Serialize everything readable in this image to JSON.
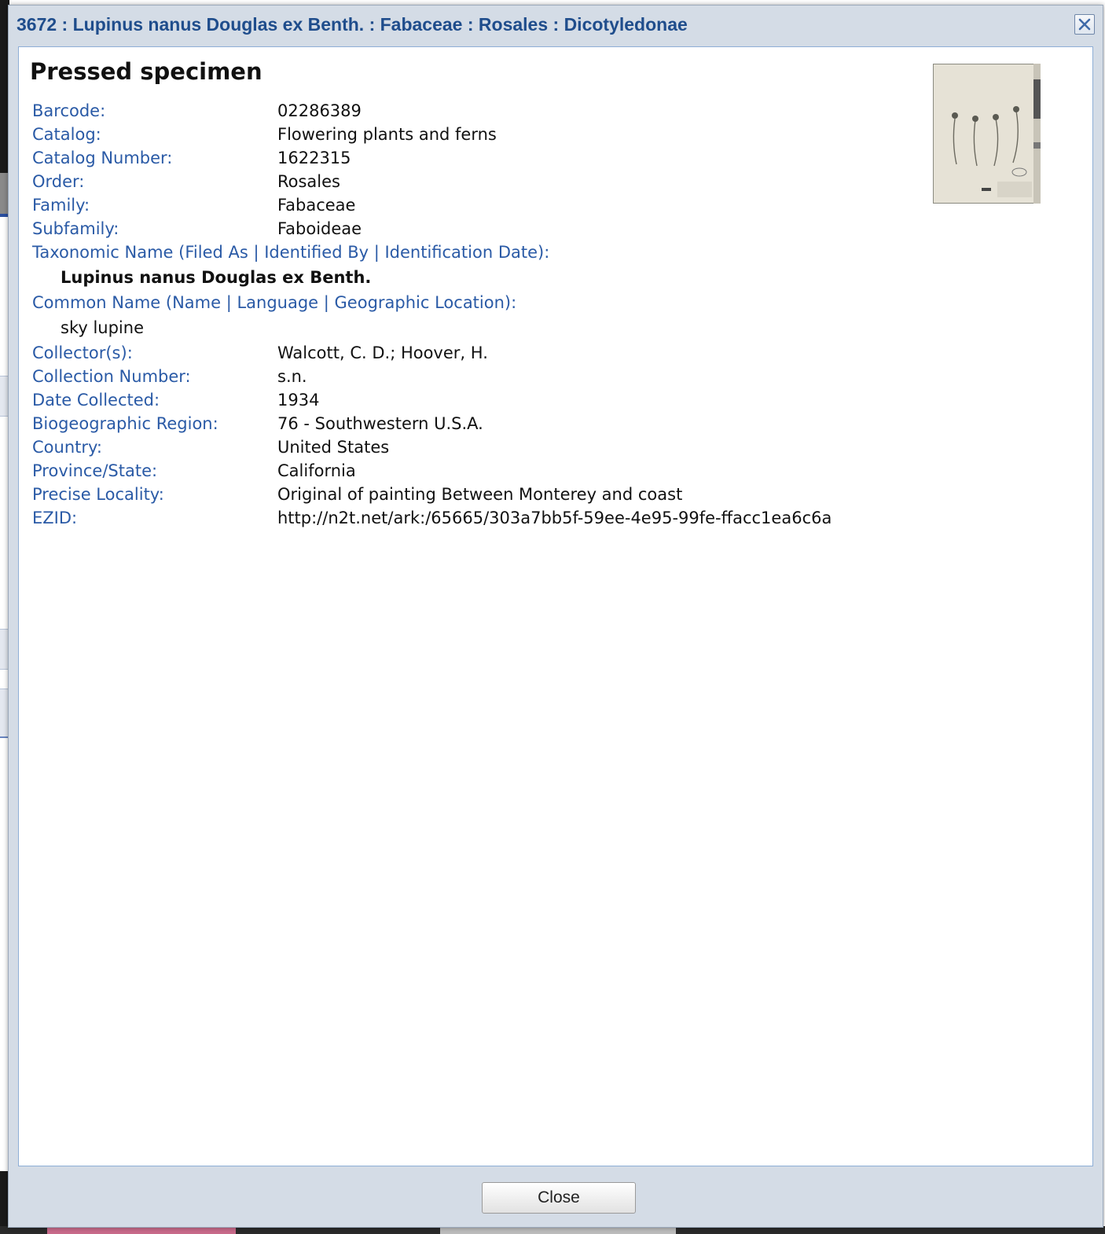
{
  "dialog": {
    "title": "3672 : Lupinus nanus Douglas ex Benth. : Fabaceae : Rosales : Dicotyledonae",
    "close_icon": "close-x-icon",
    "heading": "Pressed specimen",
    "close_button_label": "Close"
  },
  "fields": [
    {
      "label": "Barcode:",
      "value": "02286389"
    },
    {
      "label": "Catalog:",
      "value": "Flowering plants and ferns"
    },
    {
      "label": "Catalog Number:",
      "value": "1622315"
    },
    {
      "label": "Order:",
      "value": "Rosales"
    },
    {
      "label": "Family:",
      "value": "Fabaceae"
    },
    {
      "label": "Subfamily:",
      "value": "Faboideae"
    }
  ],
  "taxonomic": {
    "label": "Taxonomic Name (Filed As | Identified By | Identification Date):",
    "value": "Lupinus nanus Douglas ex Benth."
  },
  "common": {
    "label": "Common Name (Name | Language | Geographic Location):",
    "value": "sky lupine"
  },
  "fields2": [
    {
      "label": "Collector(s):",
      "value": "Walcott, C. D.; Hoover, H."
    },
    {
      "label": "Collection Number:",
      "value": "s.n."
    },
    {
      "label": "Date Collected:",
      "value": "1934"
    },
    {
      "label": "Biogeographic Region:",
      "value": "76 - Southwestern U.S.A."
    },
    {
      "label": "Country:",
      "value": "United States"
    },
    {
      "label": "Province/State:",
      "value": "California"
    },
    {
      "label": "Precise Locality:",
      "value": "Original of painting Between Monterey and coast"
    },
    {
      "label": "EZID:",
      "value": "http://n2t.net/ark:/65665/303a7bb5f-59ee-4e95-99fe-ffacc1ea6c6a"
    }
  ],
  "colors": {
    "title": "#1f4d8c",
    "label": "#2a5aa6",
    "dialog_bg": "#d4dce6"
  }
}
